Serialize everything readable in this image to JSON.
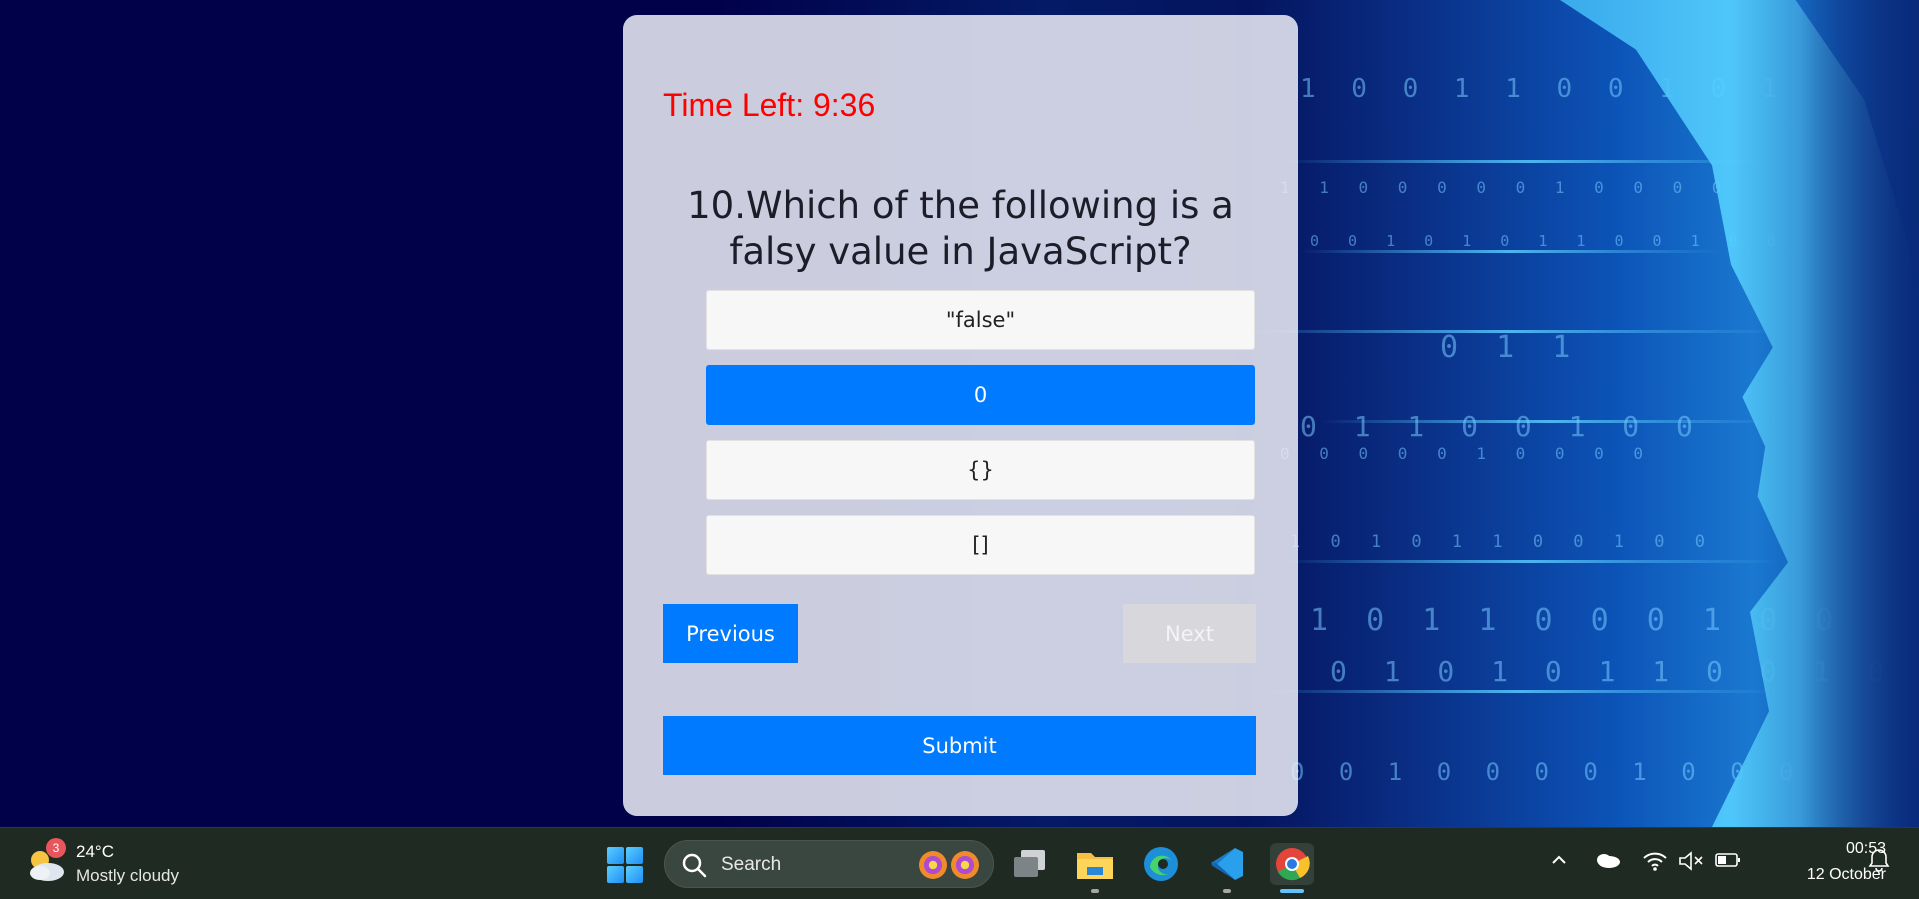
{
  "quiz": {
    "timer_label": "Time Left: 9:36",
    "question": "10.Which of the following is a falsy value in JavaScript?",
    "options": [
      "\"false\"",
      "0",
      "{}",
      "[]"
    ],
    "selected_index": 1,
    "previous_label": "Previous",
    "next_label": "Next",
    "submit_label": "Submit"
  },
  "taskbar": {
    "weather": {
      "badge_count": "3",
      "temperature": "24°C",
      "description": "Mostly cloudy",
      "icon": "partly-cloudy-night-icon"
    },
    "search_placeholder": "Search",
    "pinned_apps": [
      "start-icon",
      "task-view-icon",
      "file-explorer-icon",
      "edge-icon",
      "vscode-icon",
      "chrome-icon"
    ],
    "clock": {
      "time": "00:53",
      "date": "12 October"
    }
  },
  "colors": {
    "accent": "#007bff",
    "timer": "#ff0000",
    "card": "#eceef6",
    "taskbar": "#1f2a22"
  }
}
